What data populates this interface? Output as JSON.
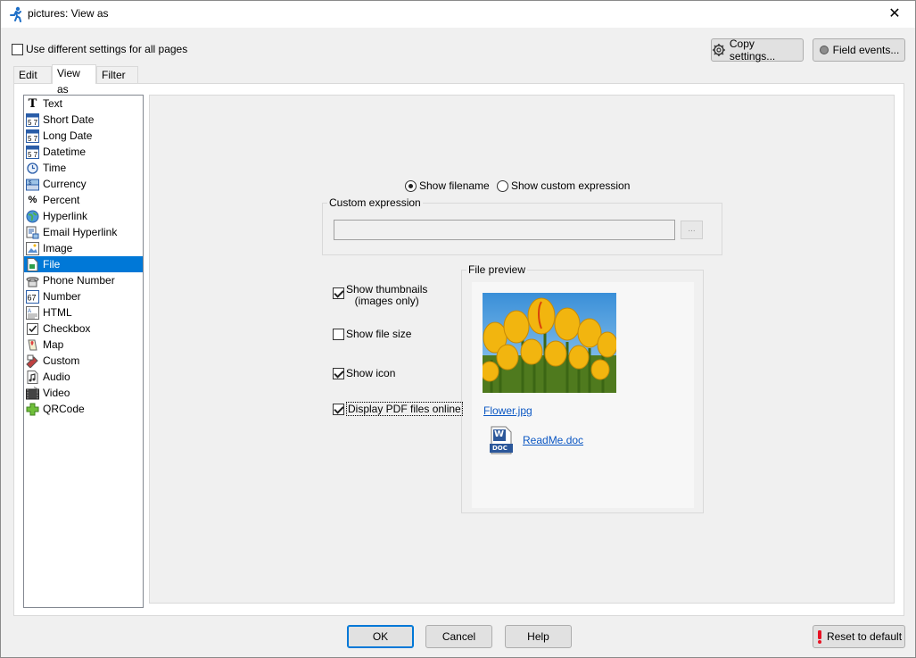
{
  "window": {
    "title": "pictures: View as",
    "close_glyph": "✕"
  },
  "top_checkbox": {
    "label": "Use different settings for all pages",
    "checked": false
  },
  "buttons": {
    "copy_settings": "Copy settings...",
    "field_events": "Field events...",
    "ok": "OK",
    "cancel": "Cancel",
    "help": "Help",
    "reset": "Reset to default"
  },
  "tabs": [
    {
      "label": "Edit as",
      "active": false
    },
    {
      "label": "View as",
      "active": true
    },
    {
      "label": "Filter as",
      "active": false
    }
  ],
  "view_types": [
    {
      "label": "Text",
      "icon": "text-icon"
    },
    {
      "label": "Short Date",
      "icon": "calendar-icon"
    },
    {
      "label": "Long Date",
      "icon": "calendar-icon"
    },
    {
      "label": "Datetime",
      "icon": "calendar-icon"
    },
    {
      "label": "Time",
      "icon": "clock-icon"
    },
    {
      "label": "Currency",
      "icon": "currency-icon"
    },
    {
      "label": "Percent",
      "icon": "percent-icon"
    },
    {
      "label": "Hyperlink",
      "icon": "globe-icon"
    },
    {
      "label": "Email Hyperlink",
      "icon": "email-icon"
    },
    {
      "label": "Image",
      "icon": "image-icon"
    },
    {
      "label": "File",
      "icon": "file-icon",
      "selected": true
    },
    {
      "label": "Phone Number",
      "icon": "phone-icon"
    },
    {
      "label": "Number",
      "icon": "number-icon"
    },
    {
      "label": "HTML",
      "icon": "html-icon"
    },
    {
      "label": "Checkbox",
      "icon": "checkbox-icon"
    },
    {
      "label": "Map",
      "icon": "map-icon"
    },
    {
      "label": "Custom",
      "icon": "custom-icon"
    },
    {
      "label": "Audio",
      "icon": "audio-icon"
    },
    {
      "label": "Video",
      "icon": "video-icon"
    },
    {
      "label": "QRCode",
      "icon": "qrcode-icon"
    }
  ],
  "display_mode": {
    "show_filename": "Show filename",
    "show_custom_expression": "Show custom expression",
    "selected": "show_filename"
  },
  "custom_expression": {
    "legend": "Custom expression",
    "value": "",
    "browse_label": "..."
  },
  "options": {
    "show_thumbnails_line1": "Show thumbnails",
    "show_thumbnails_line2": "(images only)",
    "show_thumbnails_checked": true,
    "show_file_size": "Show file size",
    "show_file_size_checked": false,
    "show_icon": "Show icon",
    "show_icon_checked": true,
    "display_pdf": "Display PDF files online",
    "display_pdf_checked": true
  },
  "file_preview": {
    "legend": "File preview",
    "image_link": "Flower.jpg",
    "doc_link": "ReadMe.doc",
    "doc_badge": "DOC",
    "doc_letter": "W"
  },
  "colors": {
    "accent": "#0078d7",
    "link": "#0b57c3",
    "reset_icon": "#e81123"
  }
}
